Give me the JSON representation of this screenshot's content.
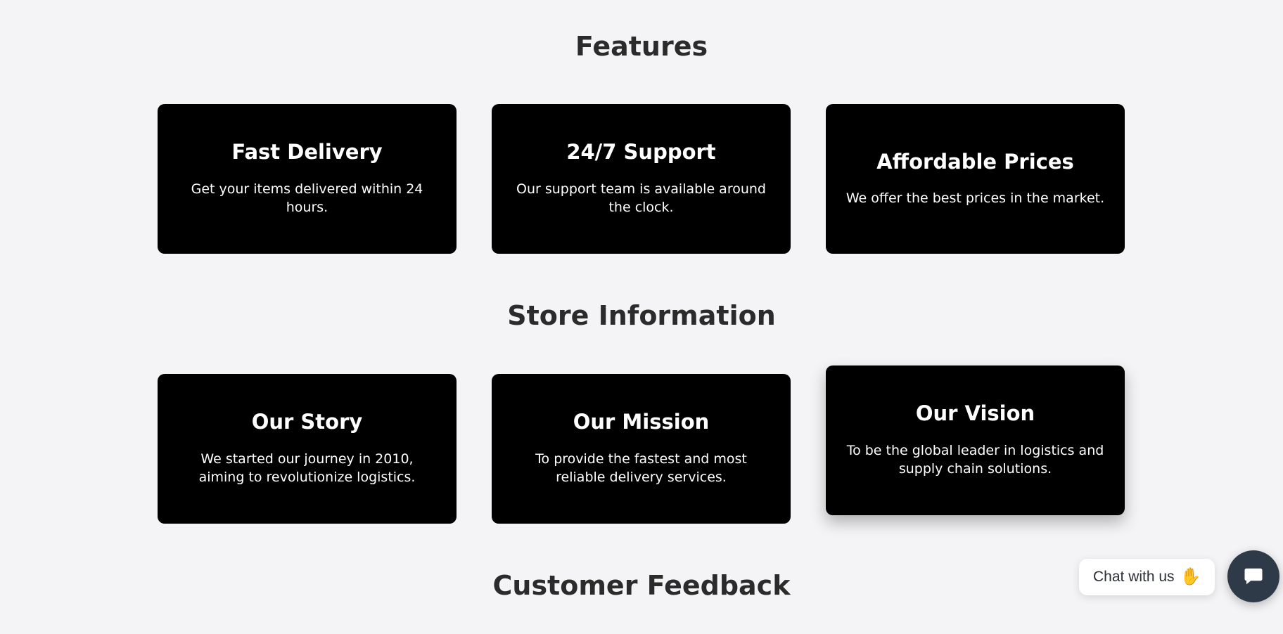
{
  "features": {
    "title": "Features",
    "cards": [
      {
        "title": "Fast Delivery",
        "text": "Get your items delivered within 24 hours."
      },
      {
        "title": "24/7 Support",
        "text": "Our support team is available around the clock."
      },
      {
        "title": "Affordable Prices",
        "text": "We offer the best prices in the market."
      }
    ]
  },
  "store_info": {
    "title": "Store Information",
    "cards": [
      {
        "title": "Our Story",
        "text": "We started our journey in 2010, aiming to revolutionize logistics."
      },
      {
        "title": "Our Mission",
        "text": "To provide the fastest and most reliable delivery services."
      },
      {
        "title": "Our Vision",
        "text": "To be the global leader in logistics and supply chain solutions."
      }
    ]
  },
  "feedback": {
    "title": "Customer Feedback"
  },
  "chat_widget": {
    "label": "Chat with us",
    "wave_icon": "waving-hand-icon",
    "button_icon": "chat-bubble-icon"
  }
}
